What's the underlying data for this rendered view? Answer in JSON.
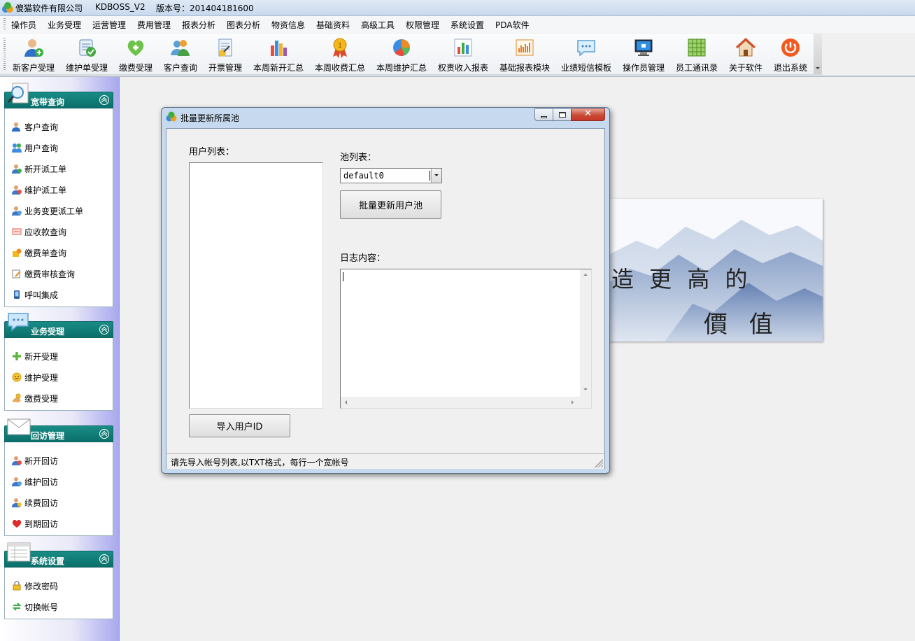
{
  "window": {
    "company": "傻猫软件有限公司",
    "app": "KDBOSS_V2",
    "version": "版本号：201404181600"
  },
  "menu": [
    "操作员",
    "业务受理",
    "运营管理",
    "费用管理",
    "报表分析",
    "图表分析",
    "物资信息",
    "基础资料",
    "高级工具",
    "权限管理",
    "系统设置",
    "PDA软件"
  ],
  "toolbar": [
    {
      "label": "新客户受理",
      "icon": "new-customer-icon"
    },
    {
      "label": "维护单受理",
      "icon": "maintenance-order-icon"
    },
    {
      "label": "缴费受理",
      "icon": "payment-heart-icon"
    },
    {
      "label": "客户查询",
      "icon": "customer-search-icon"
    },
    {
      "label": "开票管理",
      "icon": "invoice-icon"
    },
    {
      "label": "本周新开汇总",
      "icon": "weekly-new-bar-icon"
    },
    {
      "label": "本周收费汇总",
      "icon": "weekly-fee-medal-icon"
    },
    {
      "label": "本周维护汇总",
      "icon": "weekly-maintenance-pie-icon"
    },
    {
      "label": "权责收入报表",
      "icon": "income-report-icon"
    },
    {
      "label": "基础报表模块",
      "icon": "basic-report-icon"
    },
    {
      "label": "业绩短信模板",
      "icon": "sms-template-icon"
    },
    {
      "label": "操作员管理",
      "icon": "operator-monitor-icon"
    },
    {
      "label": "员工通讯录",
      "icon": "staff-directory-icon"
    },
    {
      "label": "关于软件",
      "icon": "about-house-icon"
    },
    {
      "label": "退出系统",
      "icon": "power-icon"
    }
  ],
  "sidebar": [
    {
      "title": "宽带查询",
      "icon": "magnifier-icon",
      "items": [
        {
          "label": "客户查询",
          "icon": "customer-icon"
        },
        {
          "label": "用户查询",
          "icon": "users-icon"
        },
        {
          "label": "新开派工单",
          "icon": "new-dispatch-icon"
        },
        {
          "label": "维护派工单",
          "icon": "maintenance-dispatch-icon"
        },
        {
          "label": "业务变更派工单",
          "icon": "change-dispatch-icon"
        },
        {
          "label": "应收款查询",
          "icon": "receivable-icon"
        },
        {
          "label": "缴费单查询",
          "icon": "payment-slip-icon"
        },
        {
          "label": "缴费审核查询",
          "icon": "audit-icon"
        },
        {
          "label": "呼叫集成",
          "icon": "phone-icon"
        }
      ]
    },
    {
      "title": "业务受理",
      "icon": "chat-bubble-icon",
      "items": [
        {
          "label": "新开受理",
          "icon": "plus-icon"
        },
        {
          "label": "维护受理",
          "icon": "smiley-icon"
        },
        {
          "label": "缴费受理",
          "icon": "hand-coin-icon"
        }
      ]
    },
    {
      "title": "回访管理",
      "icon": "envelope-icon",
      "items": [
        {
          "label": "新开回访",
          "icon": "new-visit-icon"
        },
        {
          "label": "维护回访",
          "icon": "maintenance-visit-icon"
        },
        {
          "label": "续费回访",
          "icon": "renew-visit-icon"
        },
        {
          "label": "到期回访",
          "icon": "heart-icon"
        }
      ]
    },
    {
      "title": "系统设置",
      "icon": "window-list-icon",
      "items": [
        {
          "label": "修改密码",
          "icon": "lock-icon"
        },
        {
          "label": "切换帐号",
          "icon": "switch-account-icon"
        }
      ]
    }
  ],
  "dialog": {
    "title": "批量更新所属池",
    "user_list_label": "用户列表：",
    "pool_list_label": "池列表：",
    "pool_selected": "default0",
    "batch_update_button": "批量更新用户池",
    "log_label": "日志内容：",
    "import_button": "导入用户ID",
    "status": "请先导入帐号列表,以TXT格式，每行一个宽帐号",
    "close_glyph": "✕"
  },
  "background_art": {
    "line1": "造 更 高 的",
    "line2": "價 值"
  }
}
